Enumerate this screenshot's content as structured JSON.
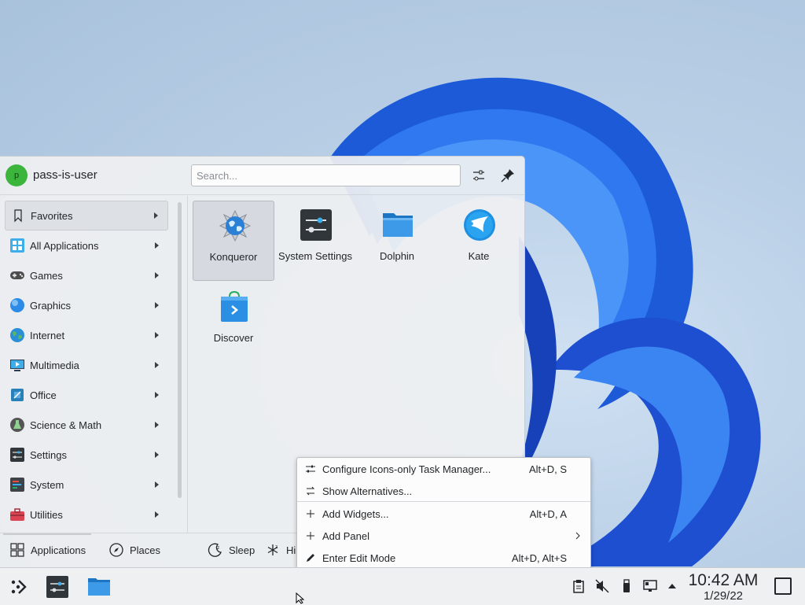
{
  "launcher": {
    "avatar_initial": "p",
    "username": "pass-is-user",
    "search_placeholder": "Search...",
    "categories": [
      {
        "label": "Favorites",
        "icon": "bookmark-icon"
      },
      {
        "label": "All Applications",
        "icon": "grid-icon"
      },
      {
        "label": "Games",
        "icon": "gamepad-icon"
      },
      {
        "label": "Graphics",
        "icon": "sphere-icon"
      },
      {
        "label": "Internet",
        "icon": "globe-icon"
      },
      {
        "label": "Multimedia",
        "icon": "monitor-play-icon"
      },
      {
        "label": "Office",
        "icon": "office-icon"
      },
      {
        "label": "Science & Math",
        "icon": "flask-icon"
      },
      {
        "label": "Settings",
        "icon": "sliders-icon"
      },
      {
        "label": "System",
        "icon": "system-icon"
      },
      {
        "label": "Utilities",
        "icon": "toolbox-icon"
      }
    ],
    "apps": [
      {
        "label": "Konqueror",
        "icon": "konqueror-icon"
      },
      {
        "label": "System Settings",
        "icon": "system-settings-icon"
      },
      {
        "label": "Dolphin",
        "icon": "folder-icon"
      },
      {
        "label": "Kate",
        "icon": "kate-icon"
      },
      {
        "label": "Discover",
        "icon": "discover-icon"
      }
    ],
    "footer": {
      "applications": "Applications",
      "places": "Places",
      "sleep": "Sleep",
      "hibernate_partial": "Hi"
    }
  },
  "context_menu": {
    "items": [
      {
        "label": "Configure Icons-only Task Manager...",
        "shortcut": "Alt+D, S",
        "icon": "configure-icon"
      },
      {
        "label": "Show Alternatives...",
        "shortcut": "",
        "icon": "alternatives-icon"
      },
      {
        "label": "Add Widgets...",
        "shortcut": "Alt+D, A",
        "icon": "plus-icon"
      },
      {
        "label": "Add Panel",
        "shortcut": "",
        "icon": "plus-icon"
      },
      {
        "label": "Enter Edit Mode",
        "shortcut": "Alt+D, Alt+S",
        "icon": "pencil-icon"
      }
    ]
  },
  "taskbar": {
    "time": "10:42 AM",
    "date": "1/29/22"
  },
  "colors": {
    "accent": "#3daee9",
    "avatar": "#3bb53b",
    "panel_bg": "#eff0f1"
  }
}
